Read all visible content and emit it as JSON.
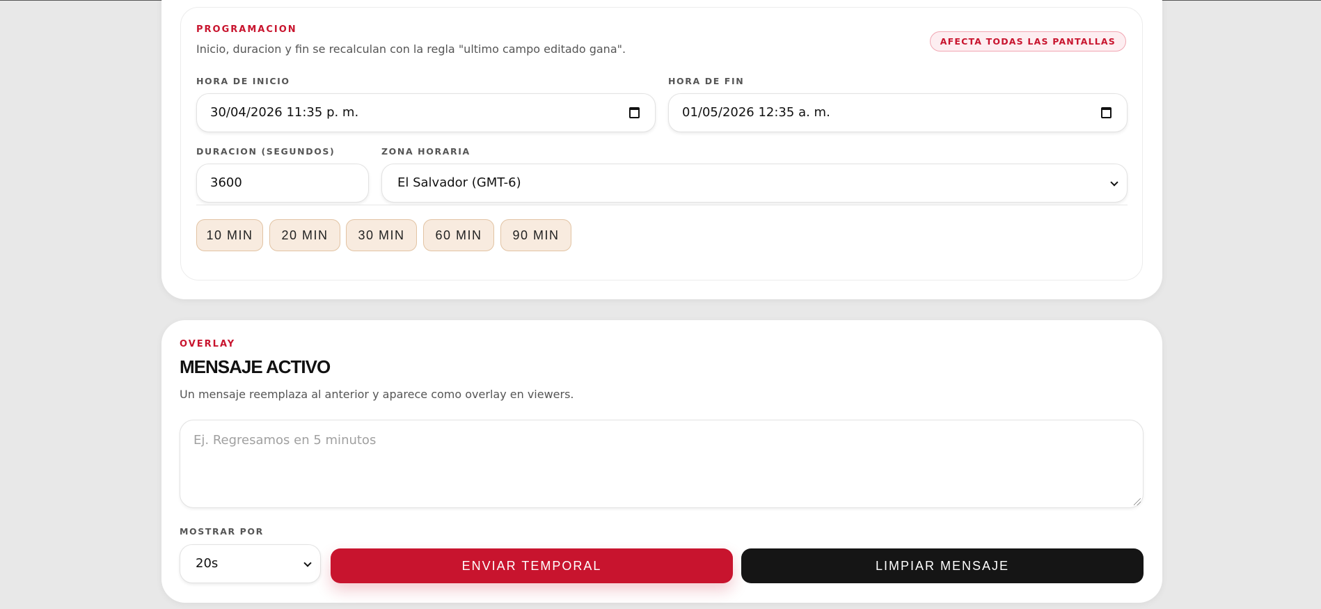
{
  "scheduling": {
    "eyebrow": "PROGRAMACION",
    "description": "Inicio, duracion y fin se recalculan con la regla \"ultimo campo editado gana\".",
    "badge": "AFECTA TODAS LAS PANTALLAS",
    "start": {
      "label": "HORA DE INICIO",
      "value": "30/04/2026 11:35 p. m."
    },
    "end": {
      "label": "HORA DE FIN",
      "value": "01/05/2026 12:35 a. m."
    },
    "duration": {
      "label": "DURACION (SEGUNDOS)",
      "value": "3600"
    },
    "timezone": {
      "label": "ZONA HORARIA",
      "value": "El Salvador (GMT-6)"
    },
    "presets": [
      "10 MIN",
      "20 MIN",
      "30 MIN",
      "60 MIN",
      "90 MIN"
    ]
  },
  "overlay": {
    "eyebrow": "OVERLAY",
    "title": "MENSAJE ACTIVO",
    "description": "Un mensaje reemplaza al anterior y aparece como overlay en viewers.",
    "message_placeholder": "Ej. Regresamos en 5 minutos",
    "show_for": {
      "label": "MOSTRAR POR",
      "value": "20s"
    },
    "send_button": "ENVIAR TEMPORAL",
    "clear_button": "LIMPIAR MENSAJE"
  },
  "colors": {
    "accent": "#c8142e",
    "dark": "#151515",
    "chip_bg": "#f8ebdf",
    "page_bg": "#e8e8e8"
  }
}
